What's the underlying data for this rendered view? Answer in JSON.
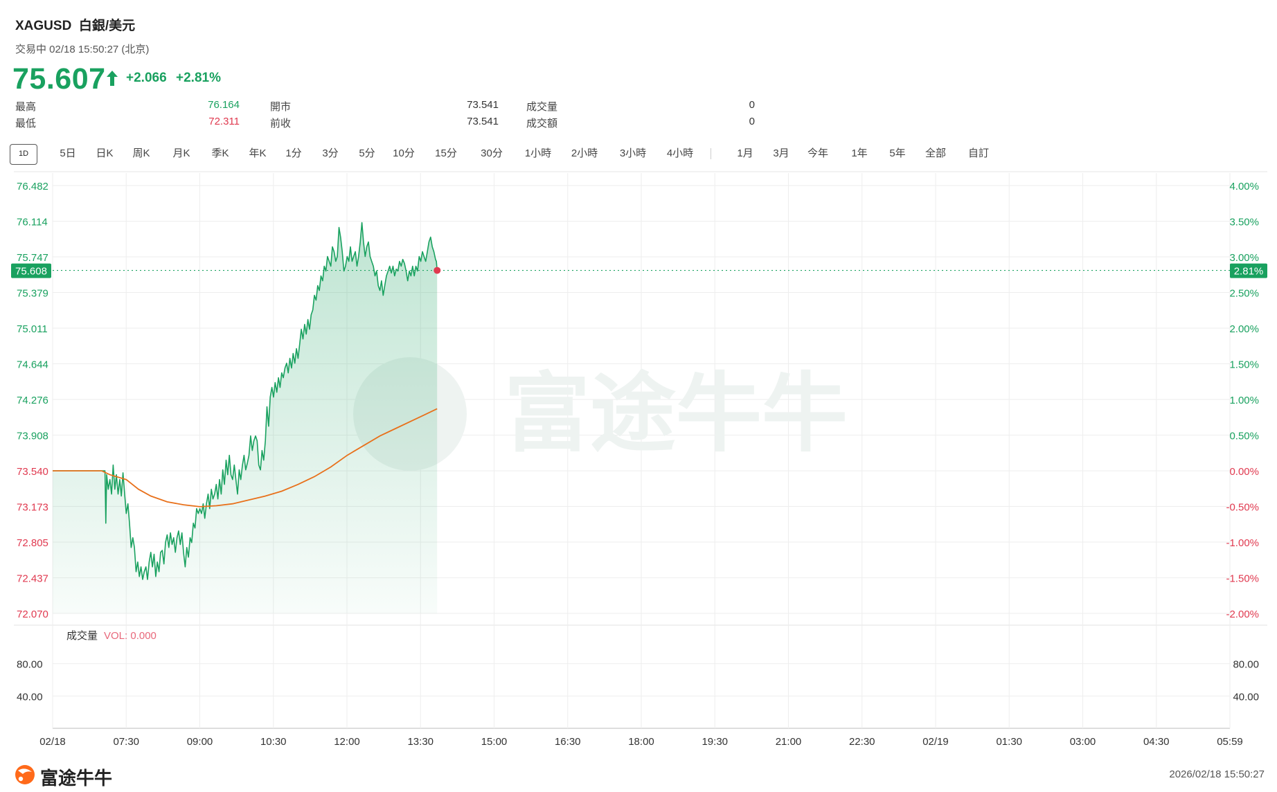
{
  "header": {
    "symbol": "XAGUSD",
    "name": "白銀/美元",
    "status": "交易中 02/18 15:50:27 (北京)",
    "price": "75.607",
    "change": "+2.066",
    "change_pct": "+2.81%"
  },
  "stats": [
    {
      "label": "最高",
      "value": "76.164",
      "color": "#19a15f"
    },
    {
      "label": "最低",
      "value": "72.311",
      "color": "#e0394f"
    },
    {
      "label": "開市",
      "value": "73.541"
    },
    {
      "label": "前收",
      "value": "73.541"
    },
    {
      "label": "成交量",
      "value": "0"
    },
    {
      "label": "成交額",
      "value": "0"
    }
  ],
  "tabs": [
    "1D",
    "5日",
    "日K",
    "周K",
    "月K",
    "季K",
    "年K",
    "1分",
    "3分",
    "5分",
    "10分",
    "15分",
    "30分",
    "1小時",
    "2小時",
    "3小時",
    "4小時",
    "1月",
    "3月",
    "今年",
    "1年",
    "5年",
    "全部",
    "自訂"
  ],
  "active_tab": "1D",
  "volume_panel": {
    "label": "成交量",
    "vol_text": "VOL: 0.000",
    "ticks": [
      "80.00",
      "40.00"
    ]
  },
  "watermark": "富途牛牛",
  "footer": {
    "brand": "富途牛牛",
    "timestamp": "2026/02/18 15:50:27"
  },
  "colors": {
    "up": "#19a15f",
    "down": "#e0394f",
    "avg_line": "#e8701a",
    "grid": "#eeeeee"
  },
  "chart_data": {
    "type": "area",
    "prev_close": 73.541,
    "current_price_label": "75.608",
    "current_pct_label": "2.81%",
    "ylim": [
      72.07,
      76.482
    ],
    "y_ticks_left": [
      "76.482",
      "76.114",
      "75.747",
      "75.379",
      "75.011",
      "74.644",
      "74.276",
      "73.908",
      "73.540",
      "73.173",
      "72.805",
      "72.437",
      "72.070"
    ],
    "y_ticks_right": [
      "4.00%",
      "3.50%",
      "3.00%",
      "2.50%",
      "2.00%",
      "1.50%",
      "1.00%",
      "0.50%",
      "0.00%",
      "-0.50%",
      "-1.00%",
      "-1.50%",
      "-2.00%"
    ],
    "x_ticks": [
      "02/18",
      "07:30",
      "09:00",
      "10:30",
      "12:00",
      "13:30",
      "15:00",
      "16:30",
      "18:00",
      "19:30",
      "21:00",
      "22:30",
      "02/19",
      "01:30",
      "03:00",
      "04:30",
      "05:59"
    ],
    "x_range_minutes": [
      360,
      1799
    ],
    "series": [
      {
        "name": "price",
        "points": [
          [
            360,
            73.54
          ],
          [
            420,
            73.54
          ],
          [
            424,
            73.54
          ],
          [
            425,
            73.0
          ],
          [
            426,
            73.5
          ],
          [
            428,
            73.35
          ],
          [
            430,
            73.45
          ],
          [
            432,
            73.3
          ],
          [
            434,
            73.6
          ],
          [
            436,
            73.35
          ],
          [
            438,
            73.5
          ],
          [
            440,
            73.3
          ],
          [
            442,
            73.45
          ],
          [
            444,
            73.28
          ],
          [
            446,
            73.52
          ],
          [
            448,
            73.3
          ],
          [
            450,
            73.1
          ],
          [
            452,
            73.2
          ],
          [
            454,
            73.0
          ],
          [
            456,
            72.75
          ],
          [
            458,
            72.85
          ],
          [
            460,
            72.75
          ],
          [
            462,
            72.5
          ],
          [
            464,
            72.6
          ],
          [
            466,
            72.45
          ],
          [
            468,
            72.55
          ],
          [
            470,
            72.42
          ],
          [
            472,
            72.5
          ],
          [
            474,
            72.55
          ],
          [
            476,
            72.42
          ],
          [
            478,
            72.6
          ],
          [
            480,
            72.7
          ],
          [
            482,
            72.55
          ],
          [
            484,
            72.68
          ],
          [
            486,
            72.45
          ],
          [
            488,
            72.6
          ],
          [
            490,
            72.5
          ],
          [
            492,
            72.7
          ],
          [
            494,
            72.72
          ],
          [
            496,
            72.58
          ],
          [
            498,
            72.8
          ],
          [
            500,
            72.88
          ],
          [
            502,
            72.75
          ],
          [
            504,
            72.9
          ],
          [
            506,
            72.78
          ],
          [
            508,
            72.85
          ],
          [
            510,
            72.7
          ],
          [
            512,
            72.85
          ],
          [
            514,
            72.92
          ],
          [
            516,
            72.78
          ],
          [
            518,
            72.9
          ],
          [
            520,
            72.7
          ],
          [
            522,
            72.55
          ],
          [
            524,
            72.75
          ],
          [
            526,
            72.65
          ],
          [
            528,
            72.85
          ],
          [
            530,
            72.8
          ],
          [
            532,
            73.0
          ],
          [
            534,
            72.95
          ],
          [
            536,
            73.15
          ],
          [
            538,
            73.1
          ],
          [
            540,
            73.15
          ],
          [
            542,
            73.1
          ],
          [
            544,
            73.2
          ],
          [
            546,
            73.05
          ],
          [
            548,
            73.2
          ],
          [
            550,
            73.3
          ],
          [
            552,
            73.15
          ],
          [
            554,
            73.35
          ],
          [
            556,
            73.25
          ],
          [
            558,
            73.3
          ],
          [
            560,
            73.4
          ],
          [
            562,
            73.25
          ],
          [
            564,
            73.45
          ],
          [
            566,
            73.3
          ],
          [
            568,
            73.55
          ],
          [
            570,
            73.4
          ],
          [
            572,
            73.65
          ],
          [
            574,
            73.5
          ],
          [
            576,
            73.7
          ],
          [
            578,
            73.5
          ],
          [
            580,
            73.45
          ],
          [
            582,
            73.6
          ],
          [
            584,
            73.45
          ],
          [
            586,
            73.3
          ],
          [
            588,
            73.55
          ],
          [
            590,
            73.45
          ],
          [
            592,
            73.6
          ],
          [
            594,
            73.7
          ],
          [
            596,
            73.55
          ],
          [
            598,
            73.62
          ],
          [
            600,
            73.7
          ],
          [
            602,
            73.9
          ],
          [
            604,
            73.75
          ],
          [
            606,
            73.85
          ],
          [
            608,
            73.9
          ],
          [
            610,
            73.85
          ],
          [
            612,
            73.6
          ],
          [
            614,
            73.55
          ],
          [
            616,
            73.75
          ],
          [
            618,
            73.65
          ],
          [
            620,
            73.85
          ],
          [
            622,
            74.2
          ],
          [
            624,
            74.0
          ],
          [
            626,
            74.3
          ],
          [
            628,
            74.4
          ],
          [
            630,
            74.3
          ],
          [
            632,
            74.45
          ],
          [
            634,
            74.35
          ],
          [
            636,
            74.5
          ],
          [
            638,
            74.4
          ],
          [
            640,
            74.55
          ],
          [
            642,
            74.5
          ],
          [
            644,
            74.6
          ],
          [
            646,
            74.65
          ],
          [
            648,
            74.55
          ],
          [
            650,
            74.7
          ],
          [
            652,
            74.6
          ],
          [
            654,
            74.75
          ],
          [
            656,
            74.65
          ],
          [
            658,
            74.8
          ],
          [
            660,
            74.7
          ],
          [
            662,
            74.85
          ],
          [
            664,
            75.0
          ],
          [
            666,
            74.9
          ],
          [
            668,
            75.05
          ],
          [
            670,
            74.95
          ],
          [
            672,
            75.1
          ],
          [
            674,
            75.0
          ],
          [
            676,
            75.15
          ],
          [
            678,
            75.2
          ],
          [
            680,
            75.35
          ],
          [
            682,
            75.3
          ],
          [
            684,
            75.45
          ],
          [
            686,
            75.4
          ],
          [
            688,
            75.55
          ],
          [
            690,
            75.5
          ],
          [
            692,
            75.65
          ],
          [
            694,
            75.6
          ],
          [
            696,
            75.75
          ],
          [
            698,
            75.7
          ],
          [
            700,
            75.65
          ],
          [
            702,
            75.85
          ],
          [
            704,
            75.8
          ],
          [
            706,
            75.7
          ],
          [
            708,
            75.75
          ],
          [
            710,
            76.05
          ],
          [
            712,
            75.95
          ],
          [
            714,
            75.8
          ],
          [
            716,
            75.6
          ],
          [
            718,
            75.65
          ],
          [
            720,
            75.75
          ],
          [
            722,
            75.7
          ],
          [
            724,
            75.85
          ],
          [
            726,
            75.7
          ],
          [
            728,
            75.75
          ],
          [
            730,
            75.8
          ],
          [
            732,
            75.65
          ],
          [
            734,
            75.75
          ],
          [
            736,
            75.9
          ],
          [
            738,
            76.1
          ],
          [
            740,
            75.9
          ],
          [
            742,
            75.75
          ],
          [
            744,
            75.85
          ],
          [
            746,
            75.9
          ],
          [
            748,
            75.75
          ],
          [
            750,
            75.7
          ],
          [
            752,
            75.65
          ],
          [
            754,
            75.55
          ],
          [
            756,
            75.6
          ],
          [
            758,
            75.45
          ],
          [
            760,
            75.4
          ],
          [
            762,
            75.5
          ],
          [
            764,
            75.35
          ],
          [
            766,
            75.45
          ],
          [
            768,
            75.55
          ],
          [
            770,
            75.6
          ],
          [
            772,
            75.65
          ],
          [
            774,
            75.58
          ],
          [
            776,
            75.65
          ],
          [
            778,
            75.55
          ],
          [
            780,
            75.62
          ],
          [
            782,
            75.6
          ],
          [
            784,
            75.7
          ],
          [
            786,
            75.65
          ],
          [
            788,
            75.72
          ],
          [
            790,
            75.68
          ],
          [
            792,
            75.6
          ],
          [
            794,
            75.5
          ],
          [
            796,
            75.6
          ],
          [
            798,
            75.55
          ],
          [
            800,
            75.65
          ],
          [
            802,
            75.55
          ],
          [
            804,
            75.65
          ],
          [
            806,
            75.6
          ],
          [
            808,
            75.75
          ],
          [
            810,
            75.7
          ],
          [
            812,
            75.8
          ],
          [
            814,
            75.75
          ],
          [
            816,
            75.7
          ],
          [
            818,
            75.8
          ],
          [
            820,
            75.9
          ],
          [
            822,
            75.95
          ],
          [
            824,
            75.85
          ],
          [
            826,
            75.8
          ],
          [
            828,
            75.72
          ],
          [
            829,
            75.7
          ],
          [
            830,
            75.607
          ]
        ]
      },
      {
        "name": "avg",
        "points": [
          [
            360,
            73.54
          ],
          [
            420,
            73.54
          ],
          [
            430,
            73.5
          ],
          [
            450,
            73.45
          ],
          [
            465,
            73.35
          ],
          [
            480,
            73.28
          ],
          [
            500,
            73.22
          ],
          [
            520,
            73.19
          ],
          [
            540,
            73.17
          ],
          [
            560,
            73.18
          ],
          [
            580,
            73.2
          ],
          [
            600,
            73.24
          ],
          [
            620,
            73.28
          ],
          [
            640,
            73.33
          ],
          [
            660,
            73.4
          ],
          [
            680,
            73.48
          ],
          [
            700,
            73.58
          ],
          [
            720,
            73.7
          ],
          [
            740,
            73.8
          ],
          [
            760,
            73.9
          ],
          [
            780,
            73.98
          ],
          [
            800,
            74.06
          ],
          [
            815,
            74.12
          ],
          [
            830,
            74.18
          ]
        ]
      }
    ]
  }
}
